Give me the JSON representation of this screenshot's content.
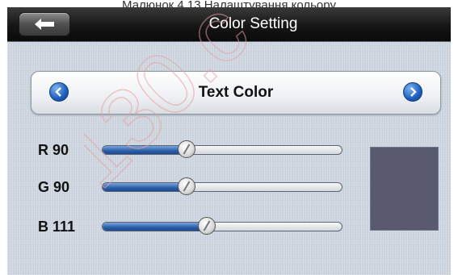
{
  "caption": "Малюнок 4.13 Налаштування кольору",
  "header": {
    "title": "Color Setting",
    "back_icon": "back-arrow-icon"
  },
  "selector": {
    "label": "Text Color",
    "prev_icon": "chevron-left-icon",
    "next_icon": "chevron-right-icon"
  },
  "sliders": [
    {
      "label": "R 90",
      "channel": "R",
      "value": 90,
      "max": 255
    },
    {
      "label": "G 90",
      "channel": "G",
      "value": 90,
      "max": 255
    },
    {
      "label": "B 111",
      "channel": "B",
      "value": 111,
      "max": 255
    }
  ],
  "preview": {
    "color": "#5a5a6f"
  },
  "watermark": {
    "text": "130.c"
  },
  "colors": {
    "accent": "#2a5ea8",
    "titlebar": "#161616",
    "panel_bg": "#c9d2dc"
  }
}
